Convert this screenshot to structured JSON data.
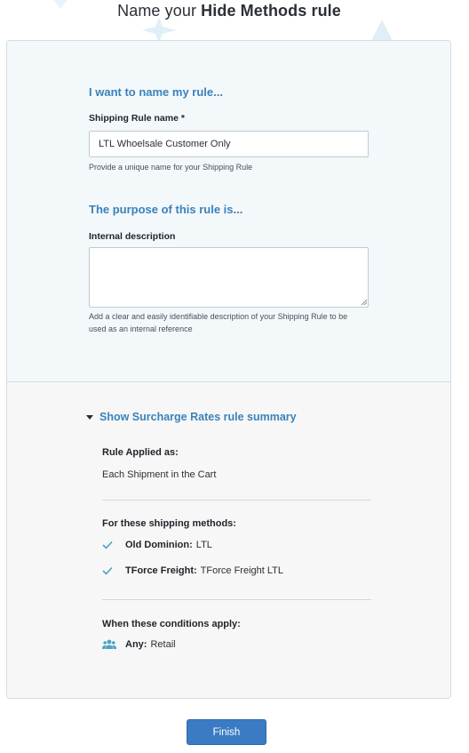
{
  "header": {
    "title_prefix": "Name your ",
    "title_strong": "Hide Methods rule"
  },
  "naming": {
    "heading": "I want to name my rule...",
    "name_label": "Shipping Rule name *",
    "name_value": "LTL Whoelsale Customer Only",
    "name_help": "Provide a unique name for your Shipping Rule"
  },
  "purpose": {
    "heading": "The purpose of this rule is...",
    "description_label": "Internal description",
    "description_value": "",
    "description_help": "Add a clear and easily identifiable description of your Shipping Rule to be used as an internal reference"
  },
  "summary": {
    "toggle_label": "Show Surcharge Rates rule summary",
    "applied_heading": "Rule Applied as:",
    "applied_value": "Each Shipment in the Cart",
    "methods_heading": "For these shipping methods:",
    "methods": [
      {
        "carrier": "Old Dominion:",
        "method": "LTL"
      },
      {
        "carrier": "TForce Freight:",
        "method": "TForce Freight LTL"
      }
    ],
    "conditions_heading": "When these conditions apply:",
    "condition": {
      "key": "Any:",
      "value": "Retail"
    }
  },
  "footer": {
    "finish_label": "Finish"
  },
  "colors": {
    "accent": "#3a82ba",
    "button": "#3a7cc3",
    "check": "#4aa3c7"
  },
  "icons": [
    "check-icon",
    "users-icon",
    "caret-down-icon",
    "resize-grip-icon"
  ]
}
